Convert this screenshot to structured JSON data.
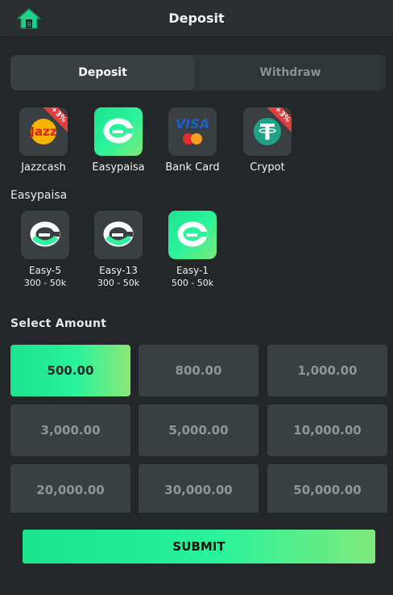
{
  "header": {
    "title": "Deposit"
  },
  "tabs": [
    {
      "label": "Deposit"
    },
    {
      "label": "Withdraw"
    }
  ],
  "methods": [
    {
      "label": "Jazzcash",
      "badge": "+3%",
      "icon": "jazzcash-logo"
    },
    {
      "label": "Easypaisa",
      "icon": "easypaisa-logo",
      "selected": true
    },
    {
      "label": "Bank Card",
      "icon": "visa-mastercard-logo"
    },
    {
      "label": "Crypot",
      "badge": "+3%",
      "icon": "tether-logo"
    }
  ],
  "channel_section": {
    "title": "Easypaisa"
  },
  "channels": [
    {
      "label": "Easy-5",
      "range": "300 - 50k"
    },
    {
      "label": "Easy-13",
      "range": "300 - 50k"
    },
    {
      "label": "Easy-1",
      "range": "500 - 50k",
      "selected": true
    }
  ],
  "amount_section": {
    "title": "Select Amount"
  },
  "amounts": [
    "500.00",
    "800.00",
    "1,000.00",
    "3,000.00",
    "5,000.00",
    "10,000.00",
    "20,000.00",
    "30,000.00",
    "50,000.00"
  ],
  "submit": {
    "label": "SUBMIT"
  },
  "colors": {
    "accent": "#2af39a",
    "background": "#23272a",
    "tile": "#3a3f42",
    "badge": "#e33d3d"
  }
}
